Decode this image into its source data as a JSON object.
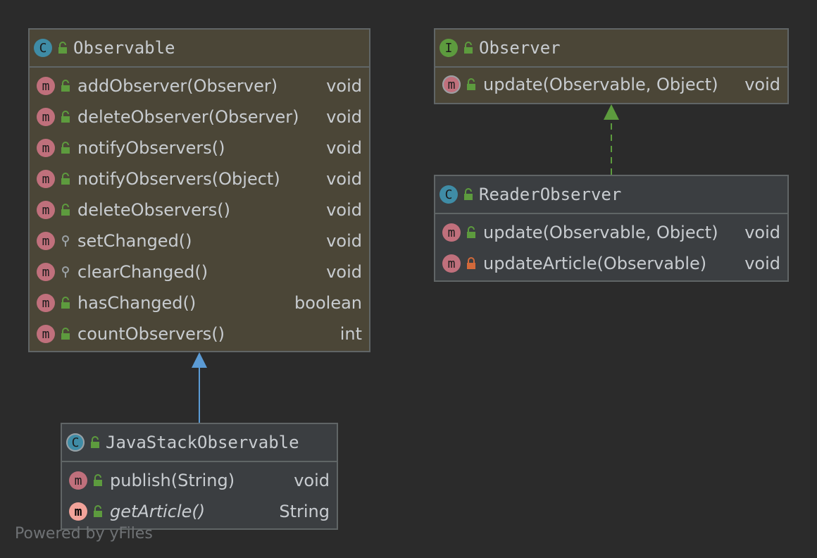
{
  "classes": {
    "observable": {
      "name": "Observable",
      "kind": "class",
      "methods": [
        {
          "name": "addObserver(Observer)",
          "return": "void",
          "visibility": "public"
        },
        {
          "name": "deleteObserver(Observer)",
          "return": "void",
          "visibility": "public"
        },
        {
          "name": "notifyObservers()",
          "return": "void",
          "visibility": "public"
        },
        {
          "name": "notifyObservers(Object)",
          "return": "void",
          "visibility": "public"
        },
        {
          "name": "deleteObservers()",
          "return": "void",
          "visibility": "public"
        },
        {
          "name": "setChanged()",
          "return": "void",
          "visibility": "protected"
        },
        {
          "name": "clearChanged()",
          "return": "void",
          "visibility": "protected"
        },
        {
          "name": "hasChanged()",
          "return": "boolean",
          "visibility": "public"
        },
        {
          "name": "countObservers()",
          "return": "int",
          "visibility": "public"
        }
      ]
    },
    "observer": {
      "name": "Observer",
      "kind": "interface",
      "methods": [
        {
          "name": "update(Observable, Object)",
          "return": "void",
          "visibility": "public"
        }
      ]
    },
    "reader_observer": {
      "name": "ReaderObserver",
      "kind": "class",
      "methods": [
        {
          "name": "update(Observable, Object)",
          "return": "void",
          "visibility": "public"
        },
        {
          "name": "updateArticle(Observable)",
          "return": "void",
          "visibility": "private"
        }
      ]
    },
    "java_stack_observable": {
      "name": "JavaStackObservable",
      "kind": "abstract-class",
      "methods": [
        {
          "name": "publish(String)",
          "return": "void",
          "visibility": "public"
        },
        {
          "name": "getArticle()",
          "return": "String",
          "visibility": "public",
          "abstract": true
        }
      ]
    }
  },
  "badges": {
    "class": "C",
    "interface": "I",
    "method": "m"
  },
  "edges": [
    {
      "from": "JavaStackObservable",
      "to": "Observable",
      "type": "extends",
      "color": "#5b9bd5"
    },
    {
      "from": "ReaderObserver",
      "to": "Observer",
      "type": "implements",
      "color": "#5d9b3e"
    }
  ],
  "colors": {
    "public": "#5d9b3e",
    "protected": "#9aa0a4",
    "private": "#d2693a"
  },
  "watermark": "Powered by yFiles"
}
